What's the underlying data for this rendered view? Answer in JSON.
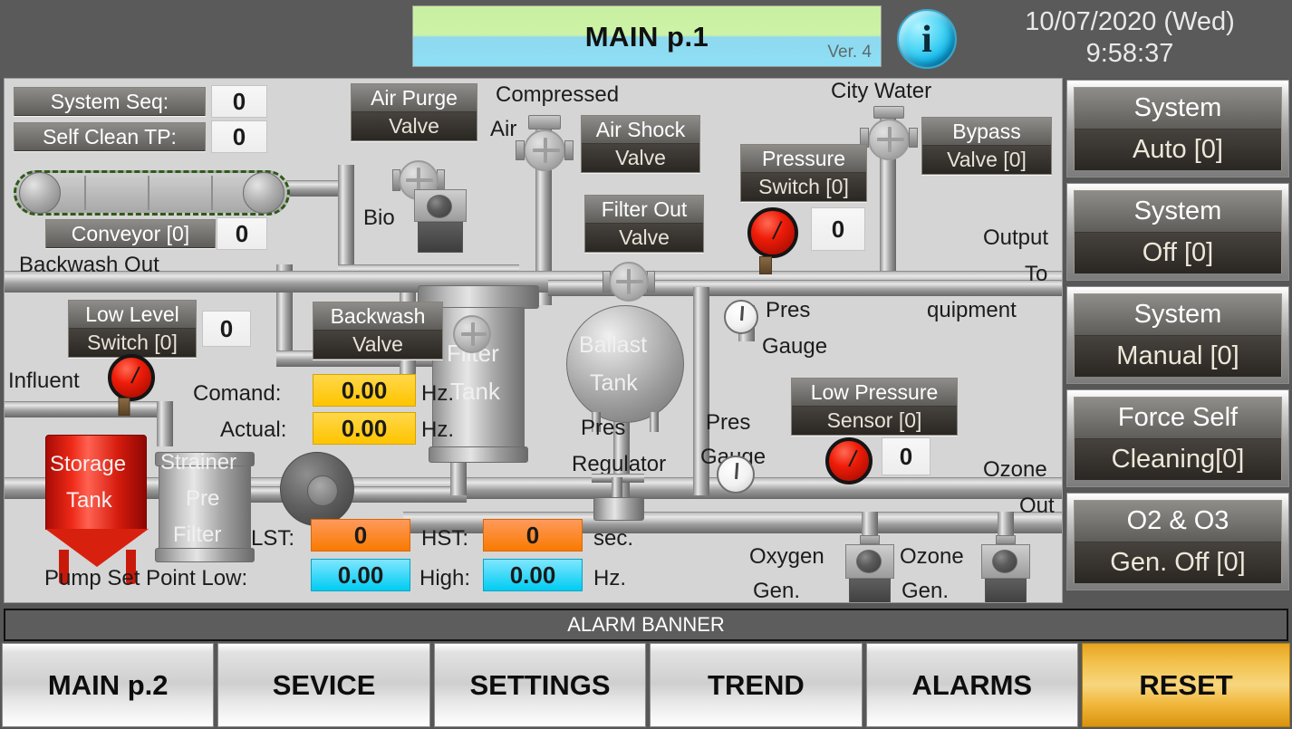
{
  "header": {
    "title": "MAIN p.1",
    "version": "Ver. 4",
    "info_icon": "info-icon",
    "date": "10/07/2020 (Wed)",
    "time": "9:58:37"
  },
  "plant": {
    "system_seq": {
      "label": "System Seq:",
      "value": "0"
    },
    "self_clean_tp": {
      "label": "Self Clean TP:",
      "value": "0"
    },
    "conveyor": {
      "label": "Conveyor [0]",
      "value": "0"
    },
    "backwash_out": "Backwash Out",
    "air_purge_valve": {
      "line1": "Air Purge",
      "line2": "Valve"
    },
    "compressed_air": {
      "line1": "Compressed",
      "line2": "Air"
    },
    "air_shock_valve": {
      "line1": "Air Shock",
      "line2": "Valve"
    },
    "filter_out_valve": {
      "line1": "Filter Out",
      "line2": "Valve"
    },
    "bio": "Bio",
    "city_water": "City Water",
    "pressure_switch": {
      "line1": "Pressure",
      "line2": "Switch [0]",
      "value": "0"
    },
    "bypass_valve": {
      "line1": "Bypass",
      "line2": "Valve [0]"
    },
    "output_to_equipment": {
      "line1": "Output",
      "line2": "To",
      "line3": "quipment"
    },
    "filter_tank": {
      "line1": "Filter",
      "line2": "Tank"
    },
    "ballast_tank": {
      "line1": "Ballast",
      "line2": "Tank"
    },
    "low_level_switch": {
      "line1": "Low Level",
      "line2": "Switch [0]",
      "value": "0"
    },
    "backwash_valve": {
      "line1": "Backwash",
      "line2": "Valve"
    },
    "influent": "Influent",
    "storage_tank": {
      "line1": "Storage",
      "line2": "Tank"
    },
    "strainer_pre_filter": {
      "line1": "Strainer",
      "line2": "Pre",
      "line3": "Filter"
    },
    "comand": {
      "label": "Comand:",
      "value": "0.00",
      "unit": "Hz."
    },
    "actual": {
      "label": "Actual:",
      "value": "0.00",
      "unit": "Hz."
    },
    "lst": {
      "label": "LST:",
      "value": "0"
    },
    "hst": {
      "label": "HST:",
      "value": "0",
      "unit": "sec."
    },
    "pump_set_point": {
      "label": "Pump Set Point Low:",
      "low_value": "0.00",
      "high_label": "High:",
      "high_value": "0.00",
      "unit": "Hz."
    },
    "pres_regulator": {
      "line1": "Pres",
      "line2": "Regulator"
    },
    "pres_gauge_mid": {
      "line1": "Pres",
      "line2": "Gauge"
    },
    "pres_gauge_top": {
      "line1": "Pres",
      "line2": "Gauge"
    },
    "low_pressure_sensor": {
      "line1": "Low Pressure",
      "line2": "Sensor [0]",
      "value": "0"
    },
    "ozone_out": {
      "line1": "Ozone",
      "line2": "Out"
    },
    "oxygen_gen": {
      "line1": "Oxygen",
      "line2": "Gen."
    },
    "ozone_gen": {
      "line1": "Ozone",
      "line2": "Gen."
    }
  },
  "side_buttons": [
    {
      "line1": "System",
      "line2": "Auto [0]"
    },
    {
      "line1": "System",
      "line2": "Off [0]"
    },
    {
      "line1": "System",
      "line2": "Manual [0]"
    },
    {
      "line1": "Force Self",
      "line2": "Cleaning[0]"
    },
    {
      "line1": "O2 & O3",
      "line2": "Gen. Off [0]"
    }
  ],
  "alarm_banner": "ALARM BANNER",
  "nav_buttons": [
    {
      "label": "MAIN p.2"
    },
    {
      "label": "SEVICE"
    },
    {
      "label": "SETTINGS"
    },
    {
      "label": "TREND"
    },
    {
      "label": "ALARMS"
    },
    {
      "label": "RESET"
    }
  ],
  "colors": {
    "background": "#5a5a5a",
    "canvas": "#d5d5d5",
    "accent_reset": "#f0b63a",
    "info": "#0fb4e8",
    "value_yellow": "#ffc400",
    "value_orange": "#f97a00",
    "value_cyan": "#00ccf2",
    "tank_red": "#ef2a18"
  }
}
